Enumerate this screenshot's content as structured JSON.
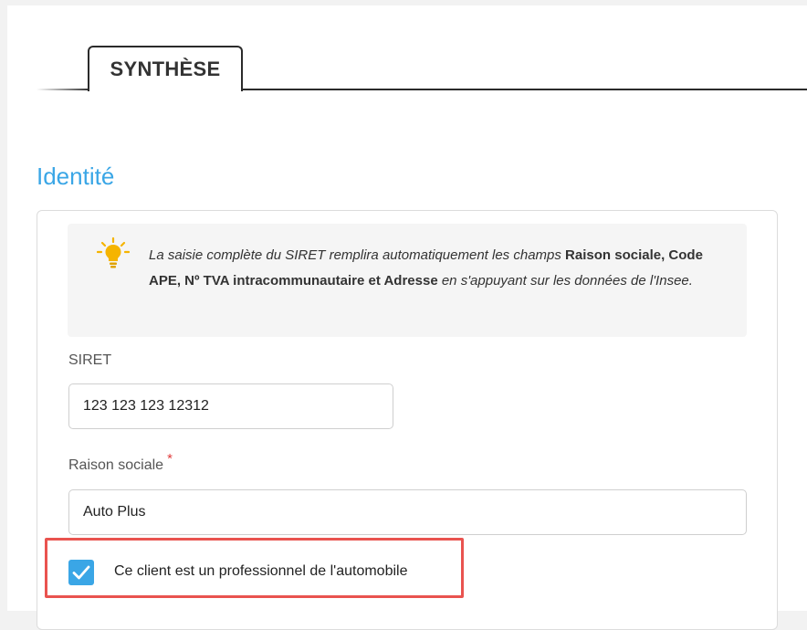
{
  "tabs": {
    "active_label": "SYNTHÈSE"
  },
  "section": {
    "title": "Identité"
  },
  "info": {
    "icon": "lightbulb-icon",
    "text_part1": "La saisie complète du SIRET remplira automatiquement les champs ",
    "text_bold": "Raison sociale, Code APE, Nº TVA intracommunautaire et Adresse",
    "text_part2": " en s'appuyant sur les données de l'Insee."
  },
  "siret": {
    "label": "SIRET",
    "value": "123 123 123 12312"
  },
  "raison_sociale": {
    "label": "Raison sociale",
    "required_mark": "*",
    "value": "Auto Plus"
  },
  "pro_auto": {
    "checked": true,
    "label": "Ce client est un professionnel de l'automobile"
  },
  "colors": {
    "accent": "#3aa6e6",
    "highlight": "#e9534f",
    "required": "#e03c3c",
    "bulb": "#f5b400"
  }
}
